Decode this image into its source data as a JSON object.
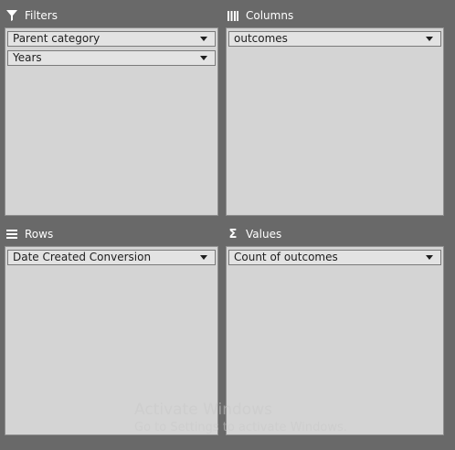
{
  "filters": {
    "title": "Filters",
    "icon": "filter-icon",
    "fields": [
      "Parent category",
      "Years"
    ]
  },
  "columns": {
    "title": "Columns",
    "icon": "columns-icon",
    "fields": [
      "outcomes"
    ]
  },
  "rows": {
    "title": "Rows",
    "icon": "rows-icon",
    "fields": [
      "Date Created Conversion"
    ]
  },
  "values": {
    "title": "Values",
    "icon": "sigma-icon",
    "fields": [
      "Count of outcomes"
    ]
  },
  "watermark": {
    "line1": "Activate Windows",
    "line2": "Go to Settings to activate Windows."
  },
  "colors": {
    "background": "#696969",
    "area": "#d4d4d4",
    "field": "#e3e3e3",
    "header_text": "#ffffff"
  }
}
